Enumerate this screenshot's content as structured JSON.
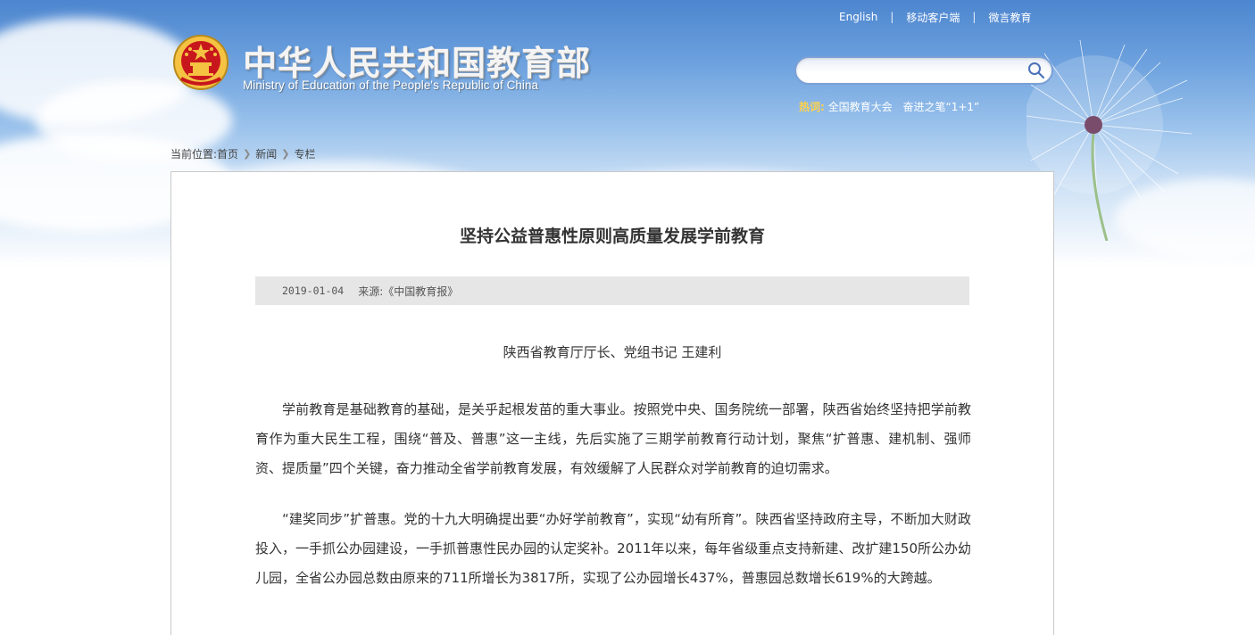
{
  "top_links": [
    "English",
    "移动客户端",
    "微言教育"
  ],
  "site": {
    "title_cn": "中华人民共和国教育部",
    "title_en": "Ministry of Education of the People's Republic of China"
  },
  "search": {
    "value": "",
    "placeholder": ""
  },
  "hot": {
    "label": "热词:",
    "items": [
      "全国教育大会",
      "奋进之笔“1+1”"
    ]
  },
  "breadcrumb": {
    "prefix": "当前位置:",
    "items": [
      "首页",
      "新闻",
      "专栏"
    ]
  },
  "article": {
    "title": "坚持公益普惠性原则高质量发展学前教育",
    "date": "2019-01-04",
    "source": "来源:《中国教育报》",
    "author": "陕西省教育厅厅长、党组书记 王建利",
    "paragraphs": [
      "学前教育是基础教育的基础，是关乎起根发苗的重大事业。按照党中央、国务院统一部署，陕西省始终坚持把学前教育作为重大民生工程，围绕“普及、普惠”这一主线，先后实施了三期学前教育行动计划，聚焦“扩普惠、建机制、强师资、提质量”四个关键，奋力推动全省学前教育发展，有效缓解了人民群众对学前教育的迫切需求。",
      "“建奖同步”扩普惠。党的十九大明确提出要“办好学前教育”，实现“幼有所育”。陕西省坚持政府主导，不断加大财政投入，一手抓公办园建设，一手抓普惠性民办园的认定奖补。2011年以来，每年省级重点支持新建、改扩建150所公办幼儿园，全省公办园总数由原来的711所增长为3817所，实现了公办园增长437%，普惠园总数增长619%的大跨越。"
    ]
  },
  "colors": {
    "sky_top": "#4d86cf",
    "meta_bar": "#e6e6e6",
    "hot_label": "#ffd24a",
    "emblem_red": "#c8161d",
    "emblem_gold": "#f5c242"
  },
  "icons": {
    "search": "magnifier-icon",
    "emblem": "national-emblem-icon",
    "breadcrumb_sep": "chevron-right-icon"
  }
}
